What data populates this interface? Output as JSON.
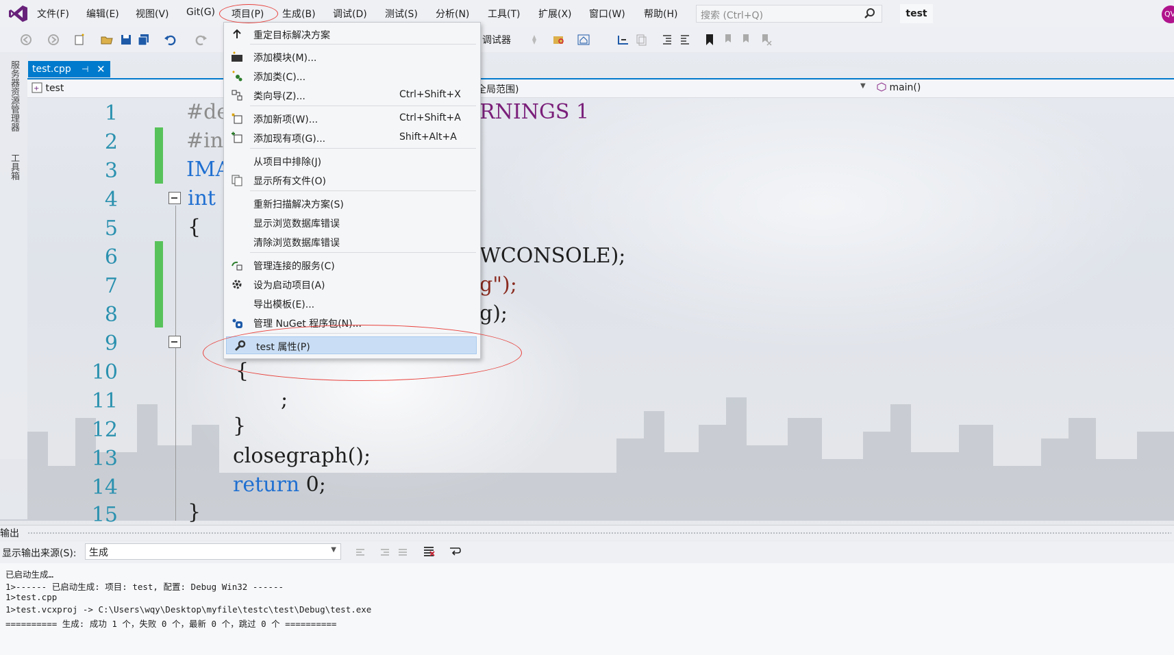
{
  "menubar": {
    "items": [
      "文件(F)",
      "编辑(E)",
      "视图(V)",
      "Git(G)",
      "项目(P)",
      "生成(B)",
      "调试(D)",
      "测试(S)",
      "分析(N)",
      "工具(T)",
      "扩展(X)",
      "窗口(W)",
      "帮助(H)"
    ],
    "search_placeholder": "搜索 (Ctrl+Q)",
    "project_badge": "test",
    "avatar_text": "QV"
  },
  "toolbar": {
    "debugger_label": "调试器"
  },
  "left_tabs": [
    "服务器资源管理器",
    "工具箱"
  ],
  "document_tab": {
    "name": "test.cpp",
    "pin": "⊣",
    "close": "✕"
  },
  "navbar": {
    "project": "test",
    "scope": "全局范围)",
    "function": "main()"
  },
  "editor": {
    "line_numbers": [
      "1",
      "2",
      "3",
      "4",
      "5",
      "6",
      "7",
      "8",
      "9",
      "10",
      "11",
      "12",
      "13",
      "14",
      "15"
    ],
    "visible_fragments": {
      "l1_left": "#de",
      "l1_right": "RNINGS 1",
      "l2_left": "#in",
      "l3_left": "IMA",
      "l4_left": "int",
      "l5_left": "{",
      "l6_right": "WCONSOLE);",
      "l7_right": "g\");",
      "l8_right": "g);",
      "l10": "{",
      "l11": ";",
      "l12": "}",
      "l13": "closegraph();",
      "l14_kw": "return",
      "l14_rest": " 0;",
      "l15": "}"
    }
  },
  "project_menu": {
    "items": [
      {
        "label": "重定目标解决方案",
        "shortcut": "",
        "icon": "arrow-up-icon"
      },
      {
        "label": "添加模块(M)...",
        "shortcut": "",
        "icon": "add-module-icon"
      },
      {
        "label": "添加类(C)...",
        "shortcut": "",
        "icon": "add-class-icon"
      },
      {
        "label": "类向导(Z)...",
        "shortcut": "Ctrl+Shift+X",
        "icon": "class-wizard-icon"
      },
      {
        "label": "添加新项(W)...",
        "shortcut": "Ctrl+Shift+A",
        "icon": "add-new-item-icon"
      },
      {
        "label": "添加现有项(G)...",
        "shortcut": "Shift+Alt+A",
        "icon": "add-existing-item-icon"
      },
      {
        "label": "从项目中排除(J)",
        "shortcut": "",
        "icon": ""
      },
      {
        "label": "显示所有文件(O)",
        "shortcut": "",
        "icon": "show-all-files-icon"
      },
      {
        "label": "重新扫描解决方案(S)",
        "shortcut": "",
        "icon": ""
      },
      {
        "label": "显示浏览数据库错误",
        "shortcut": "",
        "icon": ""
      },
      {
        "label": "清除浏览数据库错误",
        "shortcut": "",
        "icon": ""
      },
      {
        "label": "管理连接的服务(C)",
        "shortcut": "",
        "icon": "connected-services-icon"
      },
      {
        "label": "设为启动项目(A)",
        "shortcut": "",
        "icon": "gear-icon"
      },
      {
        "label": "导出模板(E)...",
        "shortcut": "",
        "icon": ""
      },
      {
        "label": "管理 NuGet 程序包(N)...",
        "shortcut": "",
        "icon": "nuget-icon"
      },
      {
        "label": "test 属性(P)",
        "shortcut": "",
        "icon": "wrench-icon"
      }
    ]
  },
  "output": {
    "title": "输出",
    "source_label": "显示输出来源(S):",
    "source_value": "生成",
    "lines": [
      "已启动生成…",
      "1>------ 已启动生成: 项目: test, 配置: Debug Win32 ------",
      "1>test.cpp",
      "1>test.vcxproj -> C:\\Users\\wqy\\Desktop\\myfile\\testc\\test\\Debug\\test.exe",
      "========== 生成: 成功 1 个，失败 0 个，最新 0 个，跳过 0 个 =========="
    ]
  },
  "colors": {
    "accent": "#007acc",
    "annotation_red": "#e8413c",
    "selected_item": "#c9def5",
    "change_bar": "#57c25a"
  }
}
